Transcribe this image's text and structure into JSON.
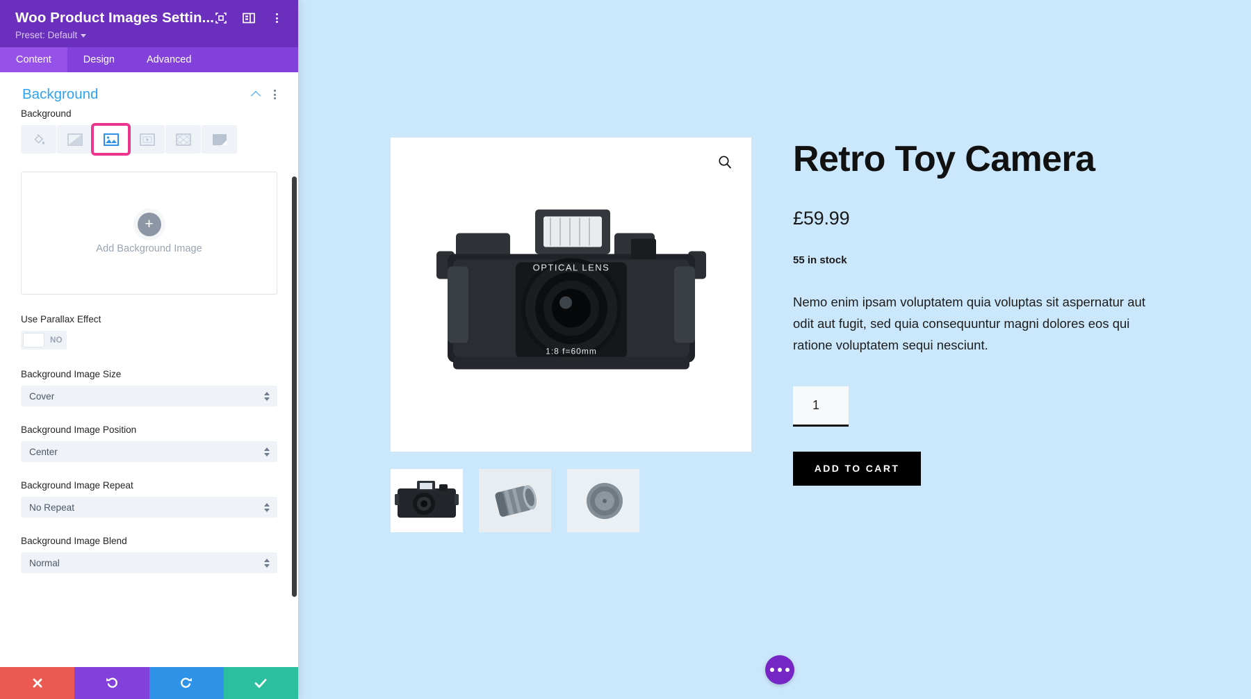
{
  "panel": {
    "title": "Woo Product Images Settin...",
    "preset_label": "Preset: Default",
    "header_icons": [
      {
        "name": "focus-target-icon"
      },
      {
        "name": "panel-layout-icon"
      },
      {
        "name": "more-options-icon"
      }
    ],
    "tabs": [
      {
        "label": "Content",
        "active": true
      },
      {
        "label": "Design",
        "active": false
      },
      {
        "label": "Advanced",
        "active": false
      }
    ],
    "section": {
      "title": "Background",
      "collapse_icon": "chevron-up-icon",
      "more_icon": "more-options-icon"
    },
    "background_field": {
      "label": "Background",
      "types": [
        {
          "name": "background-color-icon",
          "selected": false
        },
        {
          "name": "background-gradient-icon",
          "selected": false
        },
        {
          "name": "background-image-icon",
          "selected": true
        },
        {
          "name": "background-video-icon",
          "selected": false
        },
        {
          "name": "background-pattern-icon",
          "selected": false
        },
        {
          "name": "background-mask-icon",
          "selected": false
        }
      ],
      "selected_outline_color": "#ec368d",
      "selected_icon_color": "#2e93e6"
    },
    "upload": {
      "plus": "+",
      "label": "Add Background Image"
    },
    "parallax": {
      "label": "Use Parallax Effect",
      "value": "NO"
    },
    "selects": [
      {
        "label": "Background Image Size",
        "value": "Cover"
      },
      {
        "label": "Background Image Position",
        "value": "Center"
      },
      {
        "label": "Background Image Repeat",
        "value": "No Repeat"
      },
      {
        "label": "Background Image Blend",
        "value": "Normal"
      }
    ],
    "actions": [
      {
        "name": "cancel-button",
        "icon": "close-icon",
        "color": "#ea5a52"
      },
      {
        "name": "undo-button",
        "icon": "undo-icon",
        "color": "#8241da"
      },
      {
        "name": "redo-button",
        "icon": "redo-icon",
        "color": "#2e93e6"
      },
      {
        "name": "save-button",
        "icon": "check-icon",
        "color": "#2bbfa0"
      }
    ],
    "colors": {
      "header_purple": "#6b2fbd",
      "tabs_purple": "#8241da",
      "active_tab_purple": "#9551e8",
      "accent_blue": "#2ea3f2"
    }
  },
  "preview": {
    "background_color": "#cbe7fb",
    "gallery": {
      "zoom_icon": "magnifier-icon",
      "main_image_alt": "Retro Toy Camera",
      "thumbnails": [
        {
          "alt": "camera-front-thumbnail"
        },
        {
          "alt": "camera-lens-thumbnail"
        },
        {
          "alt": "lens-cap-thumbnail"
        }
      ]
    },
    "product": {
      "title": "Retro Toy Camera",
      "price": "£59.99",
      "stock": "55 in stock",
      "description": "Nemo enim ipsam voluptatem quia voluptas sit aspernatur aut odit aut fugit, sed quia consequuntur magni dolores eos qui ratione voluptatem sequi nesciunt.",
      "quantity": "1",
      "add_to_cart_label": "ADD TO CART"
    },
    "fab": {
      "name": "more-options-fab",
      "color": "#7526c4"
    }
  }
}
